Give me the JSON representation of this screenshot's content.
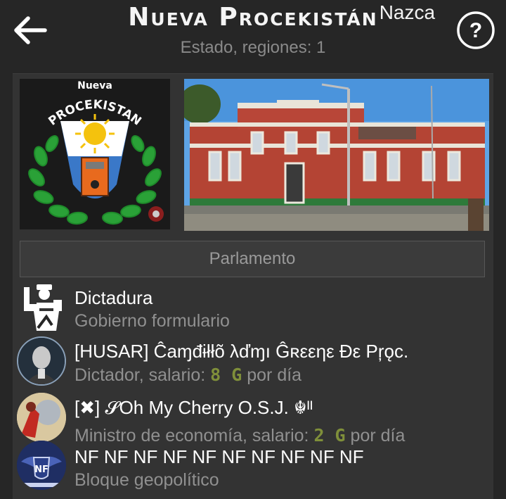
{
  "header": {
    "title": "Nueva Procekistán",
    "title_suffix": "Nazca",
    "subtitle": "Estado, regiones: 1",
    "back_icon": "arrow-left-icon",
    "help_icon": "question-circle-icon"
  },
  "emblem": {
    "text_top": "Nueva",
    "text_arc": "PROCEKISTAN"
  },
  "parliament_button": "Parlamento",
  "government": {
    "type": "Dictadura",
    "label": "Gobierno formulario"
  },
  "dictator": {
    "name": "[HUSAR] Ĉaɱđɨłłõ λďɱı Ĝʀεεηε Đε Pŗǫc.",
    "role_prefix": "Dictador, salario: ",
    "salary": "8 G",
    "role_suffix": " por día"
  },
  "minister": {
    "name": "[✖] 𝓢Oh My Cherry O.S.J. ☬ᴵᴵ",
    "role_prefix": "Ministro de economía, salario: ",
    "salary": "2 G",
    "role_suffix": " por día"
  },
  "bloc": {
    "name": "NF NF NF NF NF NF NF NF NF NF",
    "label": "Bloque geopolítico",
    "logo_text": "NF"
  },
  "colors": {
    "background": "#262626",
    "panel": "#333333",
    "gold": "#7f8f3a",
    "muted": "#909090"
  }
}
